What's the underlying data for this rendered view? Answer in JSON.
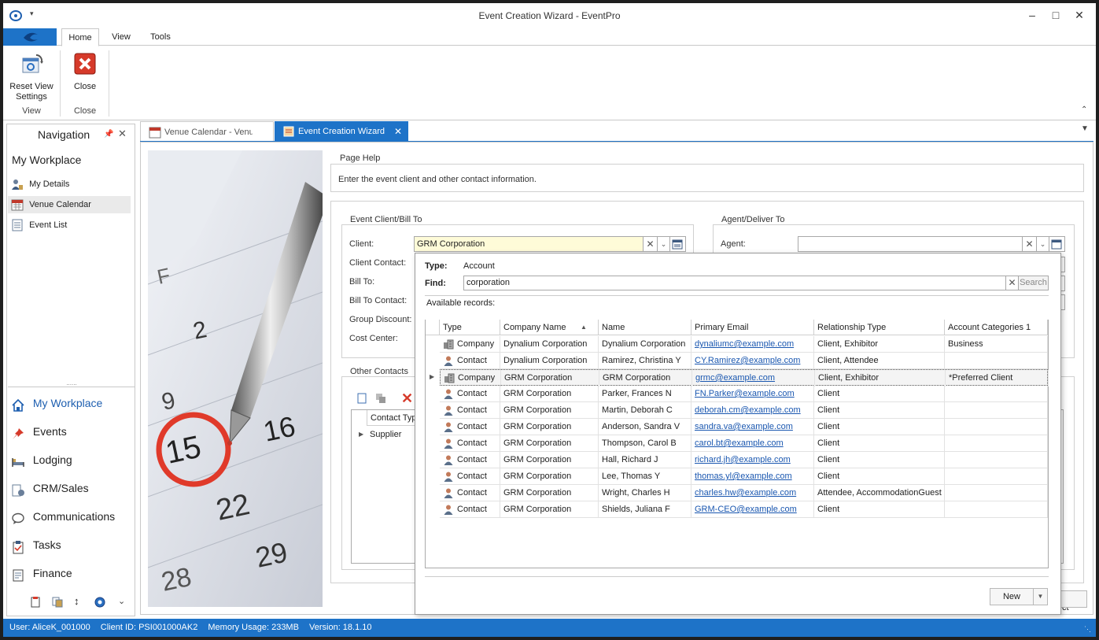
{
  "window": {
    "title": "Event Creation Wizard - EventPro"
  },
  "ribbon": {
    "tabs": [
      "Home",
      "View",
      "Tools"
    ],
    "reset_label_1": "Reset View",
    "reset_label_2": "Settings",
    "close_label": "Close",
    "group_view": "View",
    "group_close": "Close"
  },
  "navigation": {
    "title": "Navigation",
    "workplace_title": "My Workplace",
    "items": [
      "My Details",
      "Venue Calendar",
      "Event List"
    ],
    "modules": [
      "My Workplace",
      "Events",
      "Lodging",
      "CRM/Sales",
      "Communications",
      "Tasks",
      "Finance"
    ]
  },
  "doc_tabs": [
    "Venue Calendar - Venue",
    "Event Creation Wizard"
  ],
  "page_help": {
    "title": "Page Help",
    "text": "Enter the event client and other contact information."
  },
  "client_box": {
    "title": "Event Client/Bill To",
    "client_label": "Client:",
    "client_value": "GRM Corporation",
    "labels": [
      "Client Contact:",
      "Bill To:",
      "Bill To Contact:",
      "Group Discount:",
      "Cost Center:"
    ]
  },
  "agent_box": {
    "title": "Agent/Deliver To",
    "agent_label": "Agent:"
  },
  "other_contacts": {
    "title": "Other Contacts",
    "col_header": "Contact Typ",
    "row": "Supplier"
  },
  "popup": {
    "type_label": "Type:",
    "type_value": "Account",
    "find_label": "Find:",
    "find_value": "corporation",
    "search_label": "Search",
    "available": "Available records:",
    "new_label": "New",
    "columns": [
      "Type",
      "Company Name",
      "Name",
      "Primary Email",
      "Relationship Type",
      "Account Categories 1"
    ],
    "rows": [
      {
        "type": "Company",
        "company": "Dynalium Corporation",
        "name": "Dynalium Corporation",
        "email": "dynaliumc@example.com",
        "rel": "Client, Exhibitor",
        "cat": "Business"
      },
      {
        "type": "Contact",
        "company": "Dynalium Corporation",
        "name": "Ramirez, Christina Y",
        "email": "CY.Ramirez@example.com",
        "rel": "Client, Attendee",
        "cat": ""
      },
      {
        "type": "Company",
        "company": "GRM Corporation",
        "name": "GRM Corporation",
        "email": "grmc@example.com",
        "rel": "Client, Exhibitor",
        "cat": "*Preferred Client"
      },
      {
        "type": "Contact",
        "company": "GRM Corporation",
        "name": "Parker, Frances N",
        "email": "FN.Parker@example.com",
        "rel": "Client",
        "cat": ""
      },
      {
        "type": "Contact",
        "company": "GRM Corporation",
        "name": "Martin, Deborah C",
        "email": "deborah.cm@example.com",
        "rel": "Client",
        "cat": ""
      },
      {
        "type": "Contact",
        "company": "GRM Corporation",
        "name": "Anderson, Sandra V",
        "email": "sandra.va@example.com",
        "rel": "Client",
        "cat": ""
      },
      {
        "type": "Contact",
        "company": "GRM Corporation",
        "name": "Thompson, Carol B",
        "email": "carol.bt@example.com",
        "rel": "Client",
        "cat": ""
      },
      {
        "type": "Contact",
        "company": "GRM Corporation",
        "name": "Hall, Richard J",
        "email": "richard.jh@example.com",
        "rel": "Client",
        "cat": ""
      },
      {
        "type": "Contact",
        "company": "GRM Corporation",
        "name": "Lee, Thomas Y",
        "email": "thomas.yl@example.com",
        "rel": "Client",
        "cat": ""
      },
      {
        "type": "Contact",
        "company": "GRM Corporation",
        "name": "Wright, Charles H",
        "email": "charles.hw@example.com",
        "rel": "Attendee, AccommodationGuest",
        "cat": ""
      },
      {
        "type": "Contact",
        "company": "GRM Corporation",
        "name": "Shields, Juliana F",
        "email": "GRM-CEO@example.com",
        "rel": "Client",
        "cat": ""
      }
    ]
  },
  "calendar_image": {
    "numbers": [
      "F",
      "2",
      "9",
      "15",
      "16",
      "22",
      "29",
      "28"
    ]
  },
  "behind_button": "ct",
  "status": {
    "user": "User: AliceK_001000",
    "client_id": "Client ID: PSI001000AK2",
    "memory": "Memory Usage: 233MB",
    "version": "Version: 18.1.10"
  }
}
